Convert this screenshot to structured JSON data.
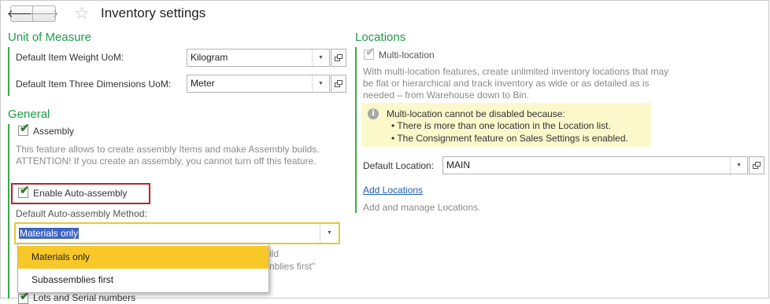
{
  "header": {
    "back_glyph": "🡐",
    "forward_glyph": "🡒",
    "favorite_glyph": "☆",
    "title": "Inventory settings"
  },
  "uom": {
    "section_title": "Unit of Measure",
    "weight_label": "Default Item Weight UoM:",
    "weight_value": "Kilogram",
    "dimensions_label": "Default Item Three Dimensions UoM:",
    "dimensions_value": "Meter"
  },
  "general": {
    "section_title": "General",
    "assembly_label": "Assembly",
    "assembly_checked": true,
    "assembly_desc": "This feature allows to create assembly Items and make Assembly builds. ATTENTION! If you create an assembly, you cannot turn off this feature.",
    "auto_assembly_label": "Enable Auto-assembly",
    "auto_assembly_checked": true,
    "method_label": "Default Auto-assembly Method:",
    "method_value": "Materials only",
    "obscured_text_line1": "ild",
    "obscured_text_line2": "nblies first\"",
    "lots_label": "Lots and Serial numbers"
  },
  "method_dropdown": {
    "options": [
      "Materials only",
      "Subassemblies first"
    ],
    "highlighted": "Materials only"
  },
  "locations": {
    "section_title": "Locations",
    "multi_label": "Multi-location",
    "multi_checked": true,
    "multi_desc": "With multi-location features, create unlimited inventory locations that may be flat or hierarchical and track inventory as wide or as detailed as is needed – from Warehouse down to Bin.",
    "warning_title": "Multi-location cannot be disabled because:",
    "warning_items": [
      "• There is more than one location in the Location list.",
      "• The Consignment feature on Sales Settings is enabled."
    ],
    "default_location_label": "Default Location:",
    "default_location_value": "MAIN",
    "add_link": "Add Locations",
    "add_desc": "Add and manage Locations."
  },
  "colors": {
    "section_green": "#1e9c48",
    "highlight_border": "#b3262a",
    "focus_border": "#e7c83a",
    "dropdown_hover": "#f7c827",
    "warning_bg": "#fbf8cc",
    "link_blue": "#1d5cb5"
  },
  "icons": {
    "dropdown_arrow": "▼",
    "check_mark": "✔",
    "info": "i"
  }
}
